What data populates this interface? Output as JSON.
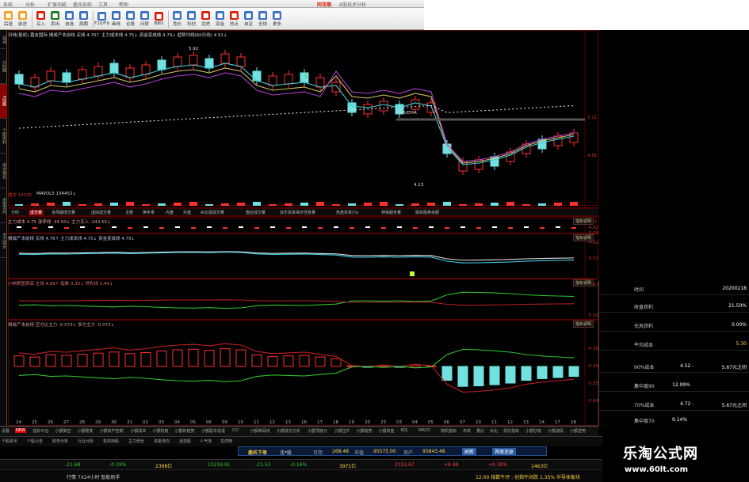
{
  "window": {
    "app_title": "同花顺",
    "subtitle": "A股技术分析",
    "menu": [
      "系统",
      "分析",
      "扩展功能",
      "委托系统",
      "工具",
      "帮助"
    ]
  },
  "toolbar": [
    {
      "label": "后退",
      "icon": "back-icon",
      "color": "#f0a020"
    },
    {
      "label": "前进",
      "icon": "forward-icon",
      "color": "#f0a020"
    },
    {
      "label": "买入",
      "icon": "buy-icon",
      "color": "#d81e06"
    },
    {
      "label": "卖出",
      "icon": "sell-icon",
      "color": "#1e7a1e"
    },
    {
      "label": "自选",
      "icon": "favorite-icon",
      "color": "#3a6fc0"
    },
    {
      "label": "周期",
      "icon": "cycle-icon",
      "color": "#3a6fc0"
    },
    {
      "label": "F10/F9",
      "icon": "f10-icon",
      "color": "#3a6fc0"
    },
    {
      "label": "画线",
      "icon": "draw-line-icon",
      "color": "#3a6fc0"
    },
    {
      "label": "论股",
      "icon": "discuss-icon",
      "color": "#3a6fc0"
    },
    {
      "label": "问财",
      "icon": "search-icon",
      "color": "#3a6fc0"
    },
    {
      "label": "BBD",
      "icon": "bbd-icon",
      "color": "#d81e06"
    },
    {
      "label": "竞价",
      "icon": "auction-icon",
      "color": "#3a6fc0"
    },
    {
      "label": "科创",
      "icon": "star-market-icon",
      "color": "#3a6fc0"
    },
    {
      "label": "龙虎",
      "icon": "dragon-tiger-icon",
      "color": "#d81e06"
    },
    {
      "label": "资金",
      "icon": "fund-icon",
      "color": "#3a6fc0"
    },
    {
      "label": "热点",
      "icon": "hot-icon",
      "color": "#d81e06"
    },
    {
      "label": "自定",
      "icon": "custom-icon",
      "color": "#3a6fc0"
    },
    {
      "label": "全球",
      "icon": "globe-icon",
      "color": "#3a6fc0"
    },
    {
      "label": "更多",
      "icon": "more-icon",
      "color": "#3a6fc0"
    }
  ],
  "left_tabs": [
    {
      "label": "自选",
      "active": false
    },
    {
      "label": "分时图",
      "active": false
    },
    {
      "label": "K线图",
      "active": true
    },
    {
      "label": "个股资料",
      "active": false
    },
    {
      "label": "综合排名",
      "active": false
    },
    {
      "label": "资金流向",
      "active": false
    },
    {
      "label": "主力增仓",
      "active": false
    }
  ],
  "main_chart": {
    "header": "日线(复权)  嘉友国际  揭成产本前线 买线 4.76↑  主力成本线 4.75↓  资金变成线 4.79↓  趋势均线(60日线) 4.91↓",
    "price_marks": [
      "5.92",
      "4.13",
      "5.11",
      "4.81"
    ],
    "label_s": "S",
    "label_ema": "EMA/EMA"
  },
  "volume_pane": {
    "header_left": "成交  13335",
    "header_right": "MAVOL5 134452↓"
  },
  "indicator_tabs": [
    "分时",
    "成交量",
    "多周期成交量",
    "虚拟成交量",
    "主散",
    "换手率",
    "内盘",
    "外盘",
    "AI云视成交量",
    "盘后成交量",
    "双乐高率揭示性筹量",
    "热盘实率(%)",
    "特殊服务量",
    "融资融券余额"
  ],
  "pane2": {
    "header": "主力成本  4.75  涨停线  -34.50↓  主力买入  -243.50↓",
    "explain": "指标说明",
    "right_labels": [
      "5.55",
      "-4.92",
      "-5.03"
    ]
  },
  "pane3": {
    "header": "揭成产本前线 买线 4.76↑  主力成本线 4.75↓  资金变成线 4.79↓",
    "explain": "指标说明",
    "right_labels": [
      "-4.92",
      "-5.03"
    ]
  },
  "pane4": {
    "header": "小纳斯图表底  主线 4.69↑  指数 0.30↓  领先线 3.44↓",
    "explain": "指标说明",
    "right_labels": [
      "-4.67",
      "-5.03"
    ]
  },
  "pane5": {
    "header": "揭成产本前线  空方比主力 -0.073↓  多方主力 -0.073↓",
    "explain": "指标说明",
    "right_labels": [
      "-0.390",
      "-0.290",
      "-0.558",
      "-0.647"
    ]
  },
  "x_axis_dates": [
    "24",
    "25",
    "26",
    "27",
    "28",
    "29",
    "30",
    "31",
    "02",
    "03",
    "04",
    "05",
    "06",
    "09",
    "10",
    "11",
    "12",
    "13",
    "16",
    "17",
    "18",
    "19",
    "20",
    "23",
    "03",
    "04",
    "05",
    "06",
    "07",
    "10",
    "11",
    "12",
    "13",
    "14",
    "17",
    "18"
  ],
  "right_panel": {
    "rows": [
      {
        "label": "时间",
        "value": "20200218"
      },
      {
        "label": "收盘获利",
        "value": "21.50%"
      },
      {
        "label": "无风获利",
        "value": "0.00%"
      },
      {
        "label": "平均成本",
        "value": "5.30"
      }
    ],
    "cost_rows": [
      {
        "label": "90%成本",
        "value": "4.52 -",
        "range": "5.67元之间"
      },
      {
        "label": "集中度90",
        "value": "12.99%",
        "range": ""
      },
      {
        "label": "70%成本",
        "value": "4.72 -",
        "range": "5.67元之间"
      },
      {
        "label": "集中度70",
        "value": "9.14%",
        "range": ""
      }
    ]
  },
  "bottom_tabs": [
    "设置",
    "NEW",
    "指标平台",
    "小额做空",
    "小额量变",
    "小额资产控制",
    "小额成本",
    "小额的趋",
    "小额的趋势",
    "小额股东进退",
    "CCI",
    "小额筹码线",
    "小额成交分析",
    "小额顶底分",
    "小额拉升",
    "小额趋势",
    "小额资金",
    "KDJ",
    "MACD",
    "随机指标",
    "布林",
    "量比",
    "价比",
    "领先指标",
    "小额抄底",
    "小额波段",
    "小额逆势",
    "小额高抛",
    "成交空间",
    "小额筹码变",
    "揭成产本前线"
  ],
  "bottom_tabs2": [
    "个股资讯",
    "个股公告",
    "财务分析",
    "行业分析",
    "机构持股",
    "主力增仓",
    "资金流向",
    "自选股",
    "人气流",
    "龙虎榜"
  ],
  "order_bar": {
    "label": "委托下单",
    "stock": "沈*股",
    "fields": [
      "可用",
      "268.48",
      "市值",
      "95575.00",
      "资产",
      "95843.48"
    ],
    "btn_refresh": "刷新",
    "btn_restore": "界面还原"
  },
  "status": {
    "index1": "-11.68",
    "index1_pct": "-0.39%",
    "index1_vol": "2398亿",
    "index2": "13219.91",
    "index2_chg": "-21.53",
    "index2_pct": "-0.16%",
    "index2_vol": "3971亿",
    "index3": "2152.67",
    "index3_chg": "+6.49",
    "index3_pct": "+0.30%",
    "index3_vol": "1463亿"
  },
  "status2": {
    "left": "行情  7X24小时  智能助手",
    "right": "12:00  指数午评 : 创指午间跌 1.35%  半导体板块"
  },
  "watermark": {
    "title": "乐淘公式网",
    "url": "www.60lt.com"
  },
  "colors": {
    "up": "#ff3030",
    "down": "#70e0e0",
    "line_white": "#e0e0e0",
    "line_yellow": "#d8c060",
    "line_purple": "#b040d0",
    "line_cyan": "#40d0e0",
    "line_green": "#30c030"
  }
}
